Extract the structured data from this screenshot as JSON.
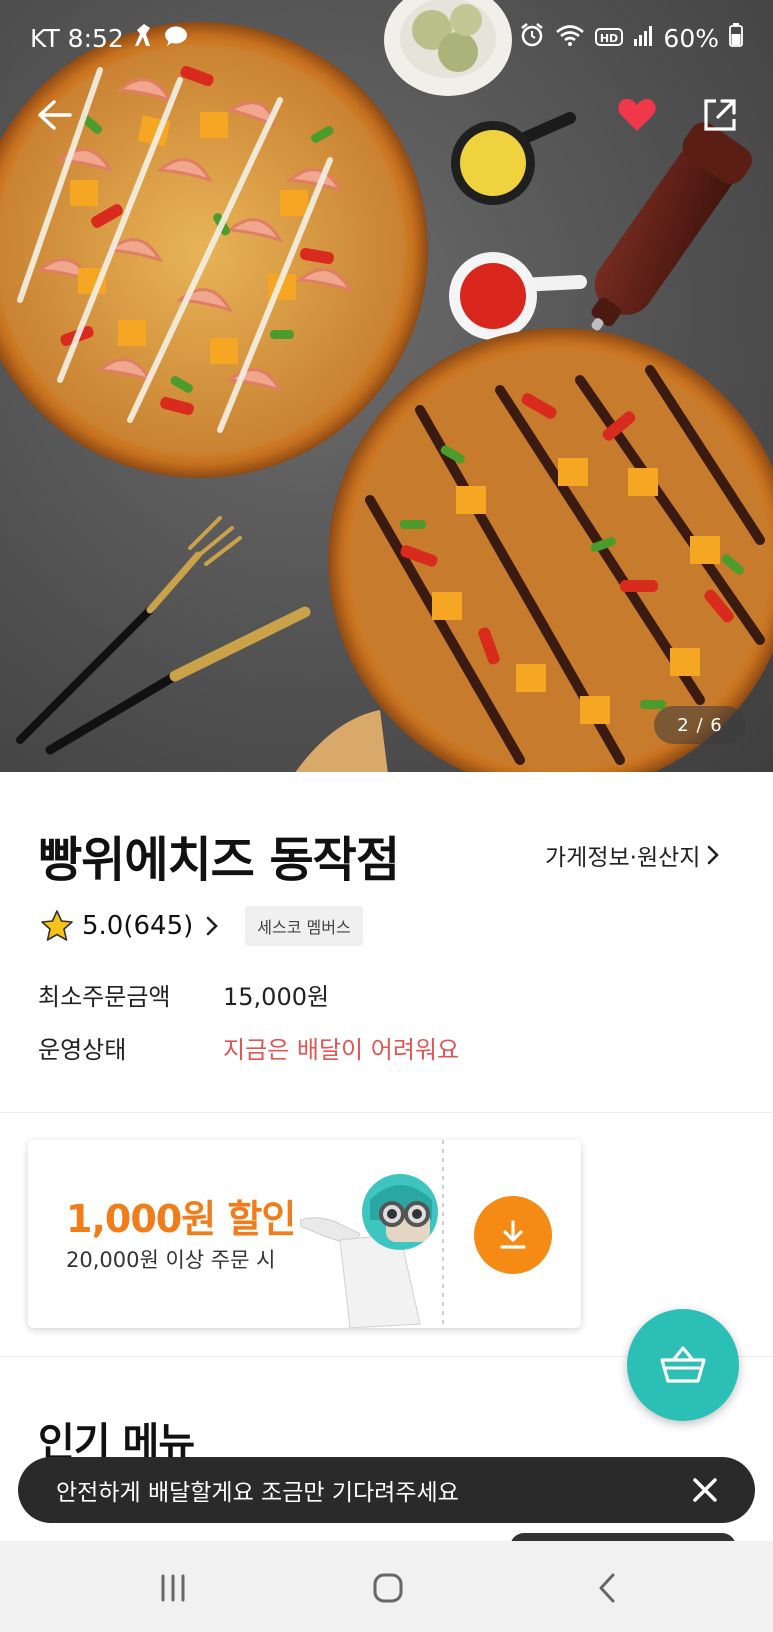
{
  "status_bar": {
    "carrier_time": "KT 8:52",
    "battery": "60%",
    "left_icons": [
      "figure-icon",
      "chat-bubble-icon"
    ],
    "right_icons": [
      "alarm-icon",
      "wifi-icon",
      "hd-icon",
      "signal-icon",
      "battery-icon"
    ]
  },
  "hero": {
    "page_indicator": "2 / 6",
    "favorited": true,
    "colors": {
      "heart": "#f0384a"
    }
  },
  "store": {
    "name": "빵위에치즈 동작점",
    "info_link": "가게정보·원산지",
    "rating": "5.0(645)",
    "badge": "세스코 멤버스",
    "min_order_label": "최소주문금액",
    "min_order_value": "15,000원",
    "status_label": "운영상태",
    "status_value": "지금은 배달이 어려워요"
  },
  "coupon": {
    "amount": "1,000원 할인",
    "condition": "20,000원 이상 주문 시",
    "colors": {
      "accent": "#f07d1a",
      "button": "#f58a14"
    }
  },
  "section": {
    "popular_menu": "인기 메뉴"
  },
  "toast": {
    "message": "안전하게 배달할게요 조금만 기다려주세요"
  },
  "fab": {
    "icon": "basket-icon",
    "color": "#2cbfb6"
  },
  "nav": {
    "icons": [
      "recent-apps-icon",
      "home-icon",
      "back-icon"
    ]
  }
}
